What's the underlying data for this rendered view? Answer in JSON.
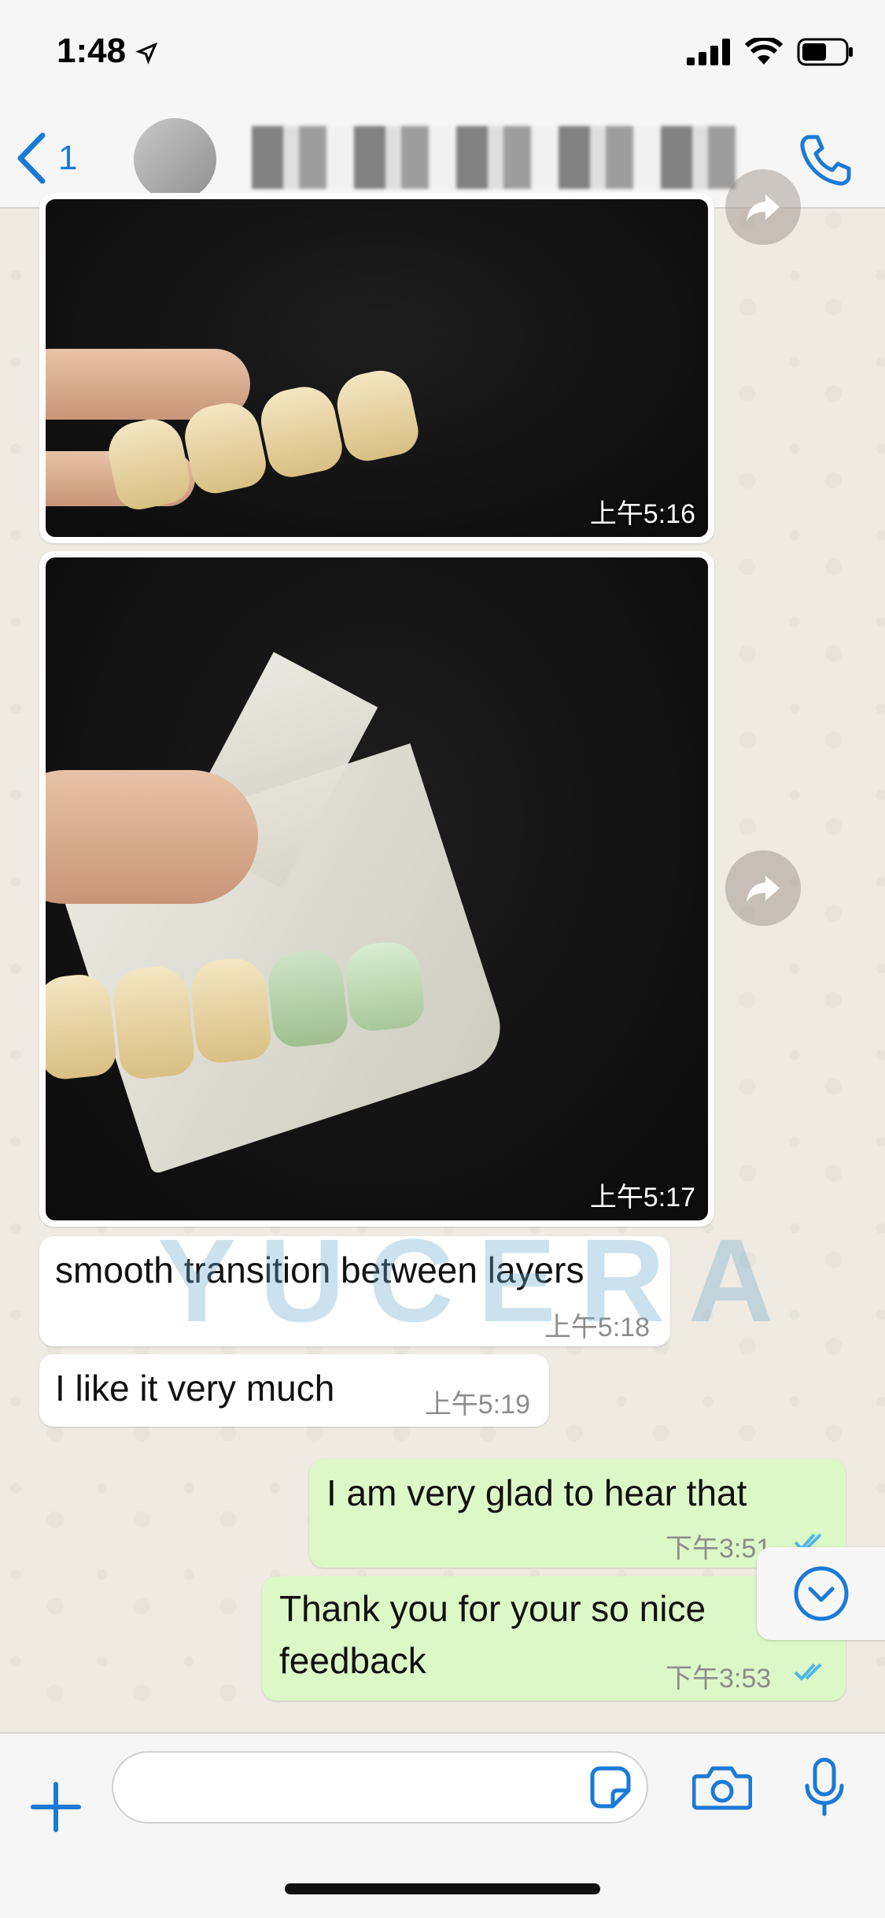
{
  "status_bar": {
    "time": "1:48"
  },
  "nav": {
    "back_count": "1"
  },
  "messages": {
    "image1_time": "上午5:16",
    "image2_time": "上午5:17",
    "in1_text": "smooth transition between layers",
    "in1_time": "上午5:18",
    "in2_text": "I like it very much",
    "in2_time": "上午5:19",
    "out1_text": "I am very glad to hear that",
    "out1_time": "下午3:51",
    "out2_line1": "Thank you for your so nice",
    "out2_line2": "feedback",
    "out2_time": "下午3:53"
  },
  "watermark": "YUCERA",
  "input": {
    "placeholder": ""
  },
  "colors": {
    "accent": "#1a7ad6",
    "incoming_bubble": "#ffffff",
    "outgoing_bubble": "#dcf8c6",
    "read_ticks": "#4fb6ec"
  }
}
